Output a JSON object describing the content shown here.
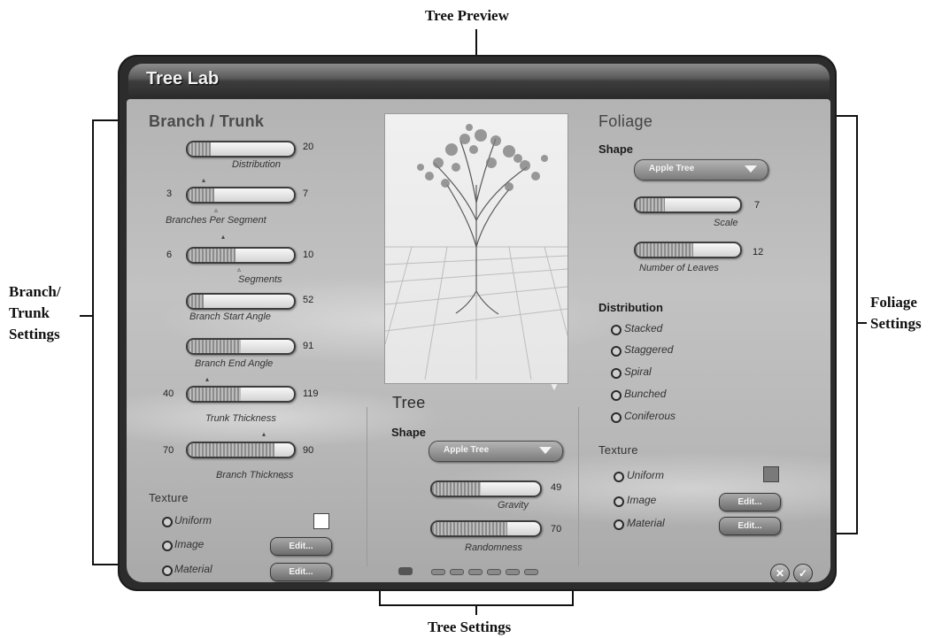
{
  "callouts": {
    "tree_preview": "Tree Preview",
    "branch_trunk_line1": "Branch/",
    "branch_trunk_line2": "Trunk",
    "branch_trunk_line3": "Settings",
    "foliage_line1": "Foliage",
    "foliage_line2": "Settings",
    "tree_settings": "Tree Settings"
  },
  "window": {
    "title": "Tree Lab"
  },
  "branch": {
    "heading": "Branch / Trunk",
    "sliders": [
      {
        "label": "Distribution",
        "left_value": "",
        "right_value": "20",
        "fill": 0.22
      },
      {
        "label": "Branches Per Segment",
        "left_value": "3",
        "right_value": "7",
        "fill": 0.25
      },
      {
        "label": "Segments",
        "left_value": "6",
        "right_value": "10",
        "fill": 0.45
      },
      {
        "label": "Branch Start Angle",
        "left_value": "",
        "right_value": "52",
        "fill": 0.15
      },
      {
        "label": "Branch End Angle",
        "left_value": "",
        "right_value": "91",
        "fill": 0.5
      },
      {
        "label": "Trunk Thickness",
        "left_value": "40",
        "right_value": "119",
        "fill": 0.5
      },
      {
        "label": "Branch Thickness",
        "left_value": "70",
        "right_value": "90",
        "fill": 0.82
      }
    ],
    "texture": {
      "heading": "Texture",
      "options": [
        "Uniform",
        "Image",
        "Material"
      ],
      "edit_label": "Edit...",
      "uniform_color": "#ffffff"
    }
  },
  "tree": {
    "heading": "Tree",
    "shape_label": "Shape",
    "shape_value": "Apple Tree",
    "sliders": [
      {
        "label": "Gravity",
        "right_value": "49",
        "fill": 0.45
      },
      {
        "label": "Randomness",
        "right_value": "70",
        "fill": 0.7
      }
    ]
  },
  "foliage": {
    "heading": "Foliage",
    "shape_label": "Shape",
    "shape_value": "Apple Tree",
    "sliders": [
      {
        "label": "Scale",
        "right_value": "7",
        "fill": 0.28
      },
      {
        "label": "Number of Leaves",
        "right_value": "12",
        "fill": 0.55
      }
    ],
    "distribution": {
      "heading": "Distribution",
      "options": [
        "Stacked",
        "Staggered",
        "Spiral",
        "Bunched",
        "Coniferous"
      ]
    },
    "texture": {
      "heading": "Texture",
      "options": [
        "Uniform",
        "Image",
        "Material"
      ],
      "edit_label": "Edit...",
      "uniform_color": "#7a7a7a"
    }
  },
  "footer": {
    "cancel_symbol": "✕",
    "ok_symbol": "✓"
  }
}
